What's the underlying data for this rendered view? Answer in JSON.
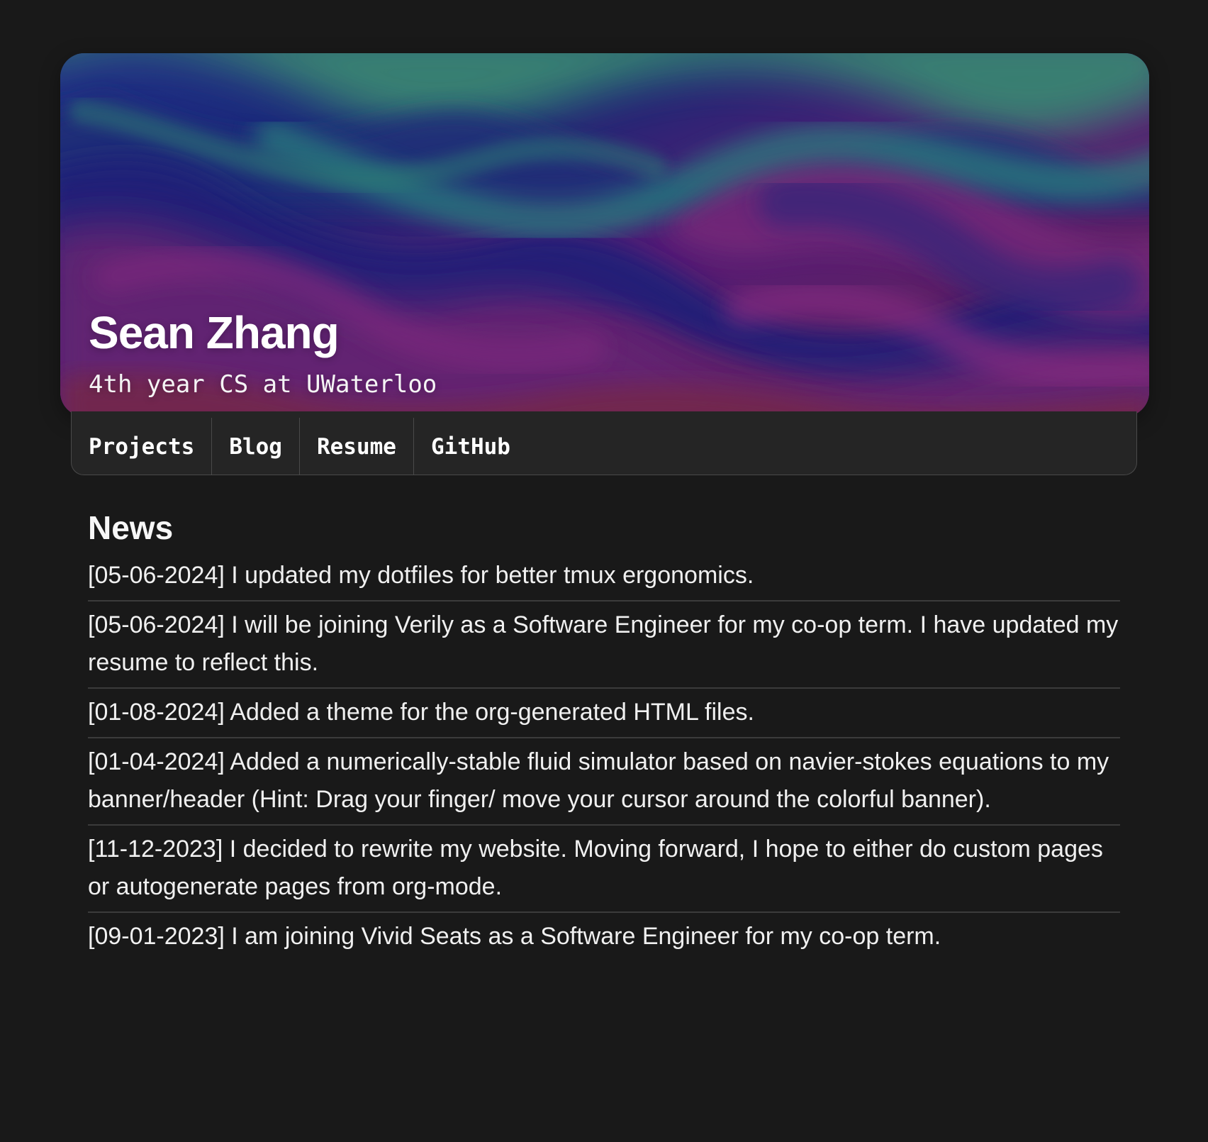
{
  "header": {
    "title": "Sean Zhang",
    "subtitle": "4th year CS at UWaterloo"
  },
  "nav": {
    "items": [
      {
        "label": "Projects"
      },
      {
        "label": "Blog"
      },
      {
        "label": "Resume"
      },
      {
        "label": "GitHub"
      }
    ]
  },
  "news": {
    "heading": "News",
    "items": [
      {
        "text": "[05-06-2024] I updated my dotfiles for better tmux ergonomics."
      },
      {
        "text": "[05-06-2024] I will be joining Verily as a Software Engineer for my co-op term. I have updated my resume to reflect this."
      },
      {
        "text": "[01-08-2024] Added a theme for the org-generated HTML files."
      },
      {
        "text": "[01-04-2024] Added a numerically-stable fluid simulator based on navier-stokes equations to my banner/header (Hint: Drag your finger/ move your cursor around the colorful banner)."
      },
      {
        "text": "[11-12-2023] I decided to rewrite my website. Moving forward, I hope to either do custom pages or autogenerate pages from org-mode."
      },
      {
        "text": "[09-01-2023] I am joining Vivid Seats as a Software Engineer for my co-op term."
      }
    ]
  },
  "theme": {
    "background": "#191919",
    "nav_background": "#252525",
    "divider": "#3b3b3b",
    "text": "#f0f0f0"
  }
}
